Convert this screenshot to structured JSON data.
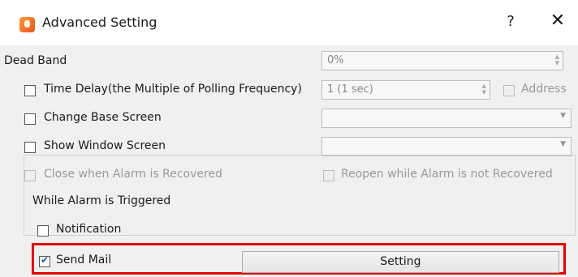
{
  "window": {
    "title": "Advanced Setting",
    "help": "?",
    "close": "✕"
  },
  "dead_band": {
    "label": "Dead Band",
    "value": "0%"
  },
  "time_delay": {
    "label": "Time Delay(the Multiple of Polling Frequency)",
    "value": "1 (1 sec)",
    "checked": false
  },
  "address": {
    "label": "Address",
    "checked": false
  },
  "change_base_screen": {
    "label": "Change Base Screen",
    "checked": false,
    "value": ""
  },
  "show_window_screen": {
    "label": "Show Window Screen",
    "checked": false,
    "value": ""
  },
  "close_when_recovered": {
    "label": "Close when Alarm is Recovered",
    "checked": false
  },
  "reopen_not_recovered": {
    "label": "Reopen while Alarm is not Recovered",
    "checked": false
  },
  "group": {
    "title": "While Alarm is Triggered"
  },
  "notification": {
    "label": "Notification",
    "checked": false
  },
  "send_mail": {
    "label": "Send Mail",
    "checked": true
  },
  "setting_button": {
    "label": "Setting"
  },
  "colors": {
    "highlight": "#e00000",
    "accent": "#1f5a9e"
  },
  "icons": {
    "app": "app-logo-icon",
    "check": "checkmark-icon",
    "spinner": "spinner-arrows-icon",
    "dropdown": "chevron-down-icon"
  }
}
